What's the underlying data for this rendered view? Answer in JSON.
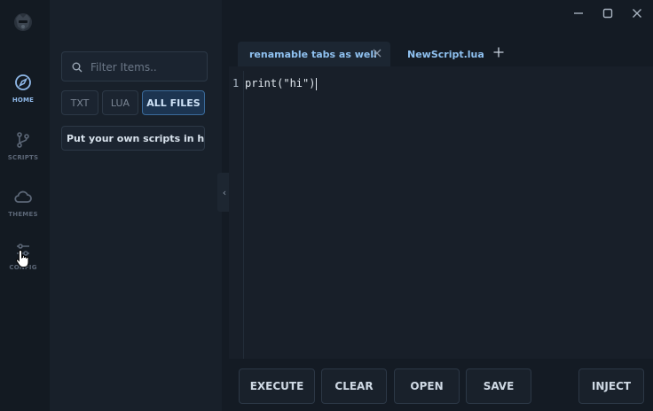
{
  "sidebar": {
    "items": [
      {
        "label": "HOME",
        "icon": "compass-icon",
        "active": true
      },
      {
        "label": "SCRIPTS",
        "icon": "git-branch-icon",
        "active": false
      },
      {
        "label": "THEMES",
        "icon": "cloud-icon",
        "active": false
      },
      {
        "label": "CONFIG",
        "icon": "sliders-icon",
        "active": false
      }
    ]
  },
  "scripts_panel": {
    "search_placeholder": "Filter Items..",
    "filters": [
      {
        "label": "TXT",
        "active": false
      },
      {
        "label": "LUA",
        "active": false
      },
      {
        "label": "ALL FILES",
        "active": true
      }
    ],
    "items": [
      {
        "label": "Put your own scripts in here"
      }
    ]
  },
  "tabs": [
    {
      "label": "renamable tabs as well",
      "active": true
    },
    {
      "label": "NewScript.lua",
      "active": false
    }
  ],
  "editor": {
    "lines": [
      {
        "number": "1",
        "code": "print(\"hi\")"
      }
    ]
  },
  "actions": {
    "execute": "EXECUTE",
    "clear": "CLEAR",
    "open": "OPEN",
    "save": "SAVE",
    "inject": "INJECT"
  },
  "colors": {
    "accent": "#8fb8e8",
    "background": "#151c25",
    "active_filter": "#1c3450"
  }
}
